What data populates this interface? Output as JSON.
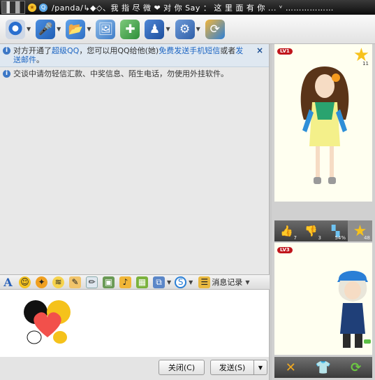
{
  "titlebar": {
    "title": "/panda/↳◆◇、我 指 尽 微 ❤ 对 你 Say ： 这 里 面 有 你 ... ᵛ ………………"
  },
  "toolbar": {
    "items": [
      {
        "icon": "webcam-icon"
      },
      {
        "icon": "microphone-icon"
      },
      {
        "icon": "file-transfer-icon"
      },
      {
        "icon": "photo-icon"
      },
      {
        "icon": "add-contact-icon"
      },
      {
        "icon": "game-icon"
      },
      {
        "icon": "settings-icon"
      },
      {
        "icon": "remote-icon"
      }
    ]
  },
  "chat": {
    "notice1": {
      "prefix": "对方开通了",
      "link1": "超级QQ",
      "middle": "，您可以用QQ给他(她)",
      "link2": "免费发送手机短信",
      "conj": "或者",
      "link3": "发送邮件",
      "suffix": "。",
      "close": "×"
    },
    "notice2": "交谈中请勿轻信汇款、中奖信息、陌生电话，勿使用外挂软件。"
  },
  "format_bar": {
    "font_glyph": "A",
    "history_label": "消息记录"
  },
  "buttons": {
    "close": "关闭(C)",
    "send": "发送(S)"
  },
  "sidebar": {
    "show1": {
      "level": "LV1",
      "stars": "11"
    },
    "ratings": [
      {
        "icon": "thumbs-up-icon",
        "value": "7"
      },
      {
        "icon": "thumbs-down-icon",
        "value": "3"
      },
      {
        "icon": "ratio-icon",
        "value": "54%"
      },
      {
        "icon": "star-icon",
        "value": "48"
      }
    ],
    "show2": {
      "level": "LV3"
    }
  },
  "colors": {
    "titlebar": "#1a1a1a",
    "chat_bg": "#e8e8e8",
    "notice_bg": "#dfe8f1",
    "link": "#1b64c2",
    "star": "#f7c21c",
    "level_badge": "#c0161c"
  }
}
